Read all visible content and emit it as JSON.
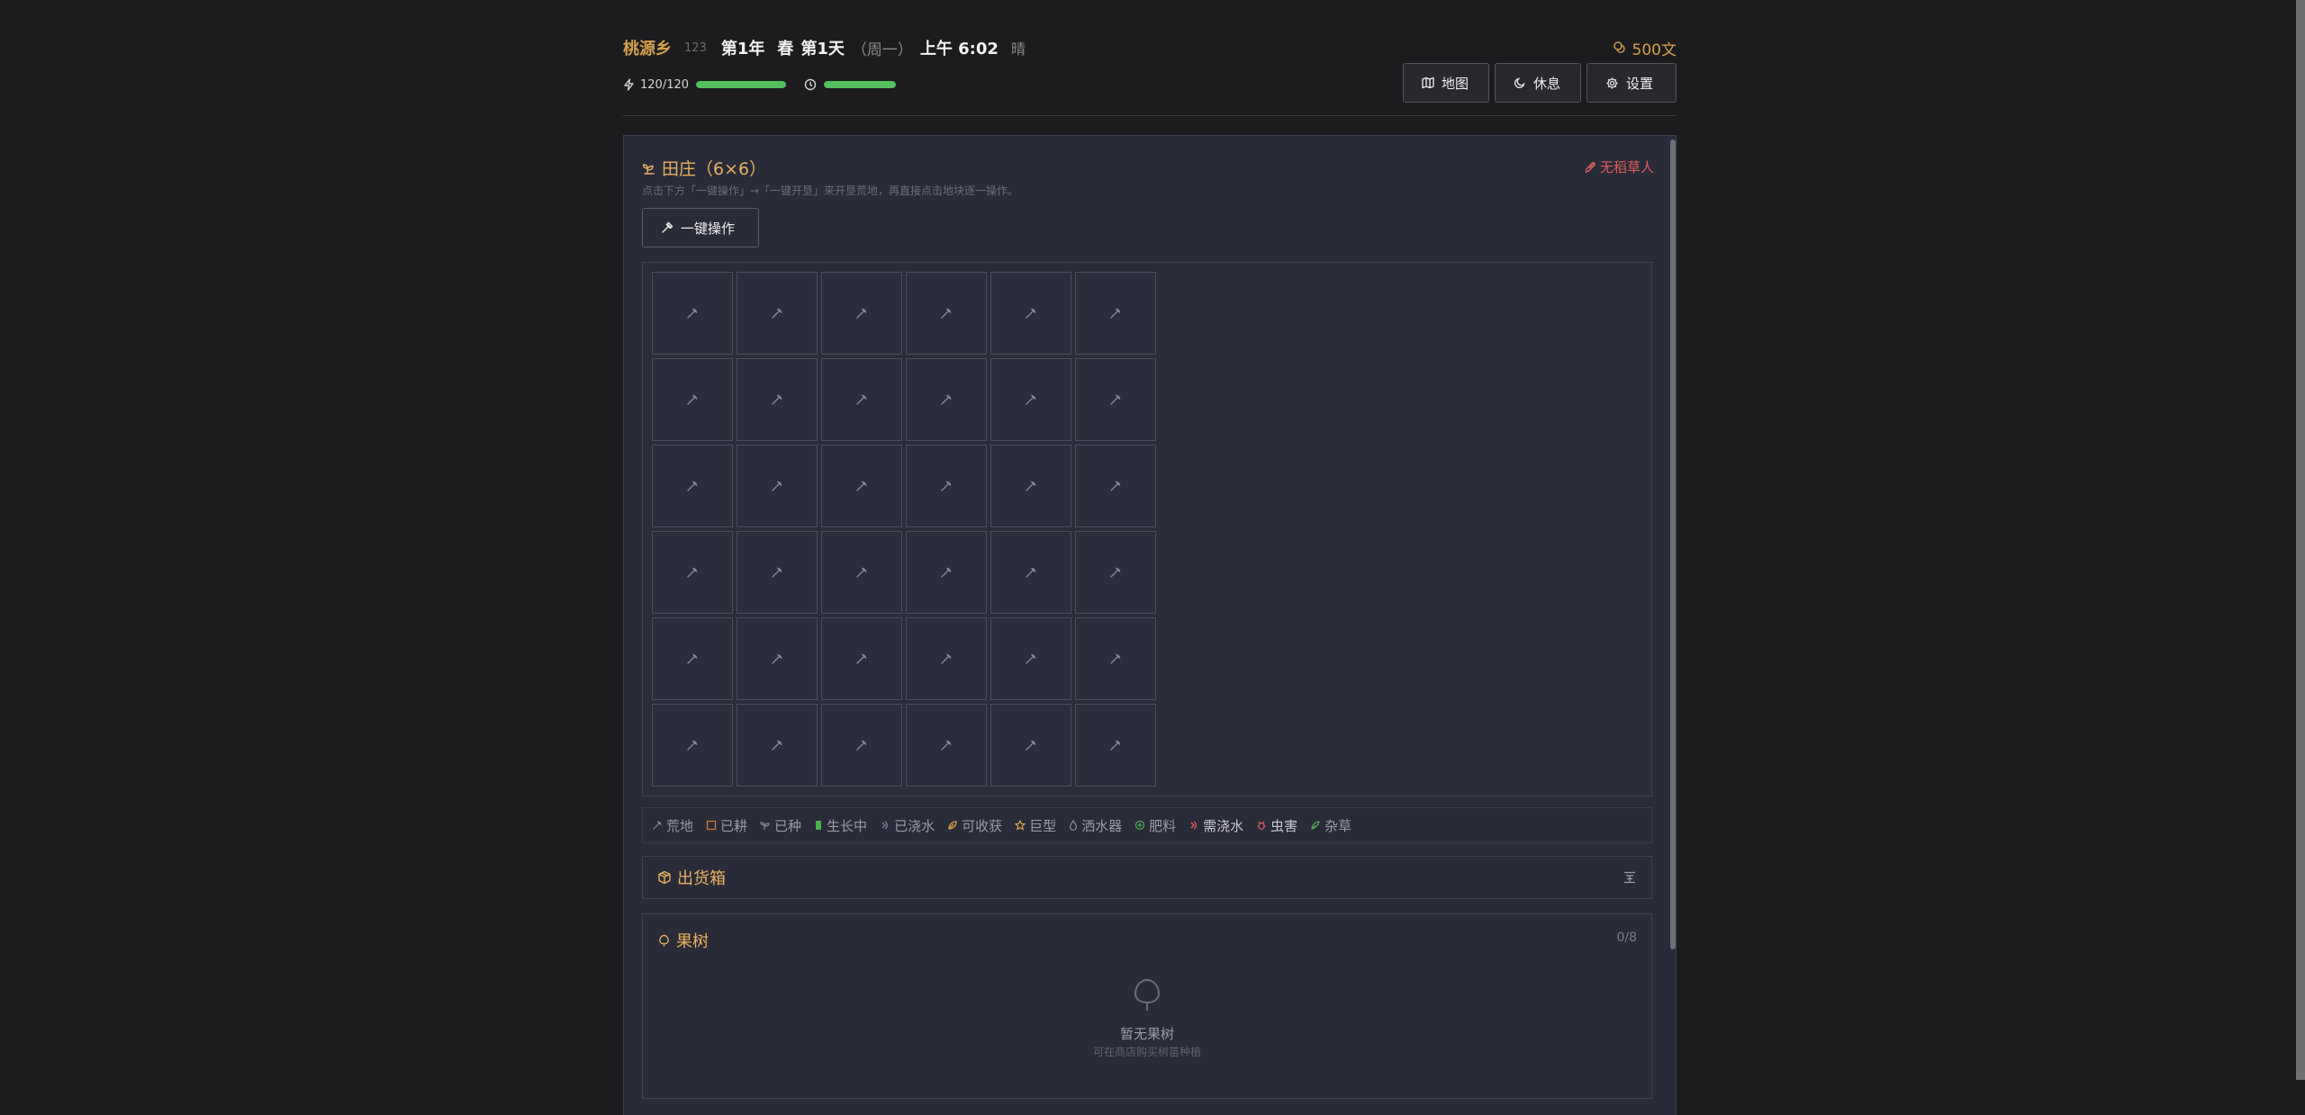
{
  "header": {
    "village": "桃源乡",
    "village_id": "123",
    "year": "第1年",
    "season": "春",
    "day": "第1天",
    "weekday": "（周一）",
    "time": "上午 6:02",
    "weather": "晴",
    "money": "500文",
    "energy_text": "120/120",
    "energy_fraction": 1.0,
    "time_fraction": 1.0,
    "buttons": {
      "map": "地图",
      "rest": "休息",
      "settings": "设置"
    }
  },
  "farm": {
    "title": "田庄（6×6）",
    "warning": "无稻草人",
    "hint": "点击下方「一键操作」→「一键开垦」来开垦荒地，再直接点击地块逐一操作。",
    "one_click": "一键操作",
    "cols": 6,
    "rows": 6,
    "plot_state": "荒地"
  },
  "legend": [
    {
      "label": "荒地",
      "icon": "hoe-icon",
      "color": "#8a8b98"
    },
    {
      "label": "已耕",
      "icon": "tilled-square-icon",
      "color": "#c97a3a"
    },
    {
      "label": "已种",
      "icon": "sprout-icon",
      "color": "#8a8b98"
    },
    {
      "label": "生长中",
      "icon": "growing-icon",
      "color": "#4caf50"
    },
    {
      "label": "已浇水",
      "icon": "watered-icon",
      "color": "#7a8aa8"
    },
    {
      "label": "可收获",
      "icon": "harvest-icon",
      "color": "#d4a04c"
    },
    {
      "label": "巨型",
      "icon": "star-icon",
      "color": "#d4a04c"
    },
    {
      "label": "洒水器",
      "icon": "droplet-icon",
      "color": "#8a8b98"
    },
    {
      "label": "肥料",
      "icon": "fertilizer-icon",
      "color": "#4caf50"
    },
    {
      "label": "需浇水",
      "icon": "needs-water-icon",
      "color": "#e05c5c"
    },
    {
      "label": "虫害",
      "icon": "bug-icon",
      "color": "#e05c5c"
    },
    {
      "label": "杂草",
      "icon": "weed-icon",
      "color": "#4caf50"
    }
  ],
  "shipbox": {
    "title": "出货箱"
  },
  "fruit_trees": {
    "title": "果树",
    "count": "0/8",
    "empty": "暂无果树",
    "empty_hint": "可在商店购买树苗种植"
  },
  "colors": {
    "accent": "#e8b060",
    "energy": "#52c05e",
    "danger": "#e05c5c",
    "panel": "#2a2b38"
  }
}
